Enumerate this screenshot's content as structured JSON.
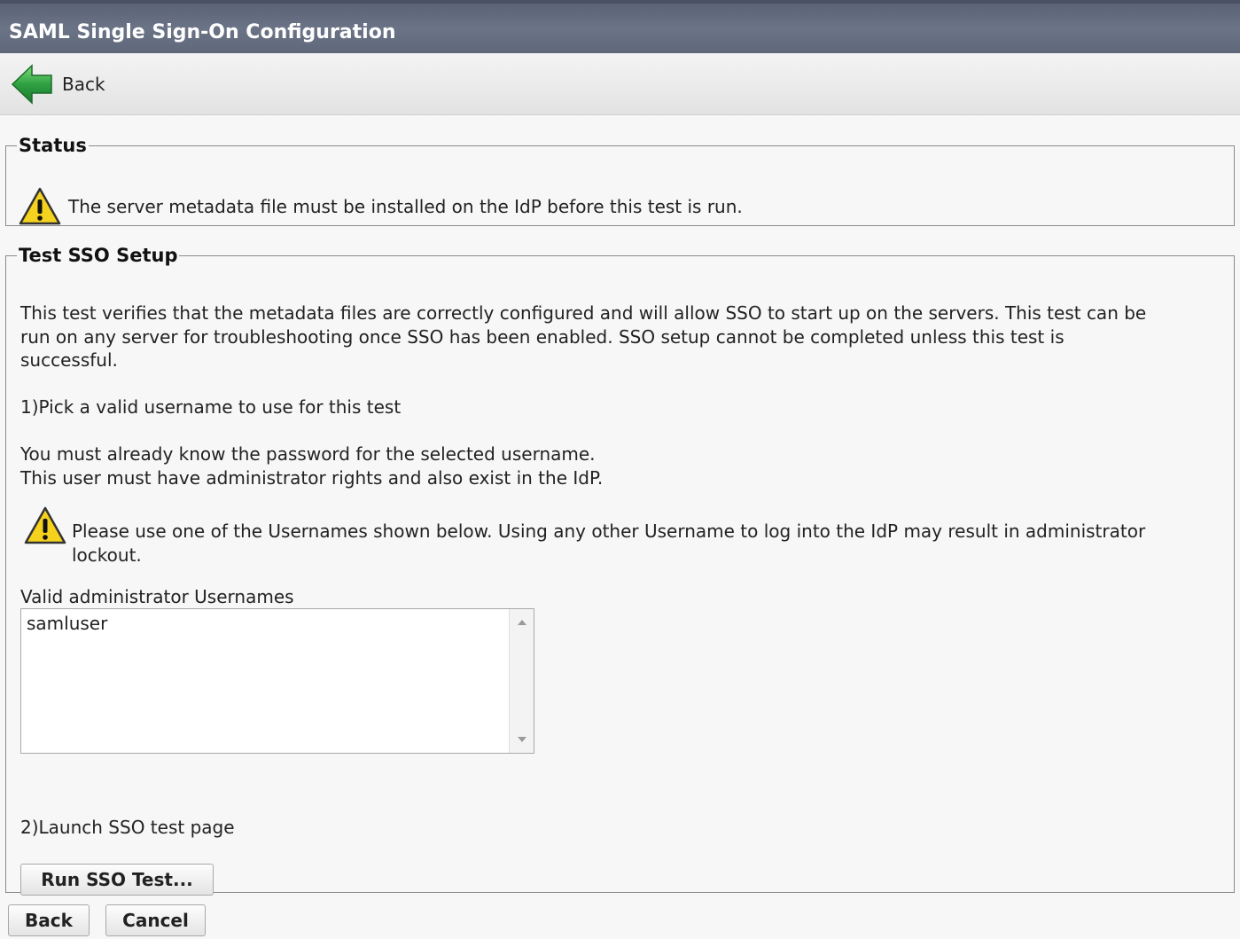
{
  "window": {
    "title": "SAML Single Sign-On Configuration"
  },
  "toolbar": {
    "back_label": "Back",
    "back_icon": "green-left-arrow-icon"
  },
  "status": {
    "legend": "Status",
    "message": "The server metadata file must be installed on the IdP before this test is run.",
    "icon": "warning-icon"
  },
  "test": {
    "legend": "Test SSO Setup",
    "description_lines": [
      "This test verifies that the metadata files are correctly configured and will allow SSO to start up on the servers. This test can be",
      "run on any server for troubleshooting once SSO has been enabled. SSO setup cannot be completed unless this test is",
      "successful."
    ],
    "step1": "1)Pick a valid username to use for this test",
    "note_lines": [
      "You must already know the password for the selected username.",
      "This user must have administrator rights and also exist in the IdP."
    ],
    "warning_lines": [
      "Please use one of the Usernames shown below. Using any other Username to log into the IdP may result in administrator",
      "lockout."
    ],
    "usernames_label": "Valid administrator Usernames",
    "usernames": [
      "samluser"
    ],
    "step2": "2)Launch SSO test page",
    "run_button": "Run SSO Test..."
  },
  "footer": {
    "back_button": "Back",
    "cancel_button": "Cancel"
  },
  "colors": {
    "titlebar": "#5f677a",
    "toolbar": "#e8e8e8",
    "background": "#f7f7f7",
    "warning_yellow": "#f5d21e",
    "back_arrow_green": "#2ea043"
  }
}
